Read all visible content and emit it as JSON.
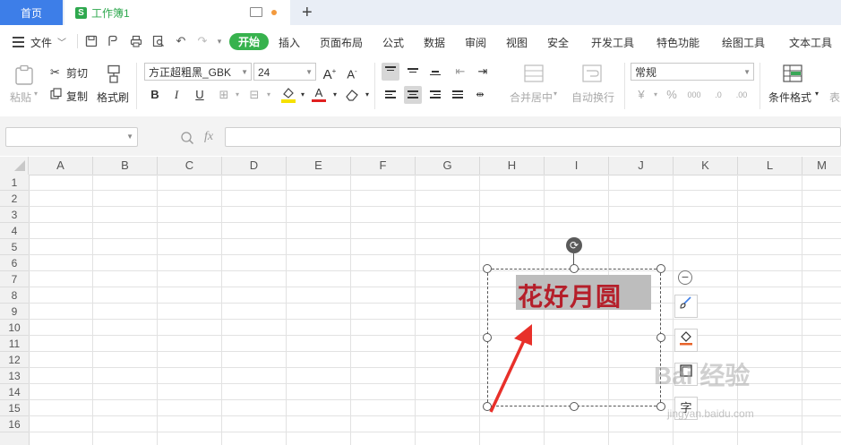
{
  "tabs": {
    "home": "首页",
    "workbook": "工作簿1",
    "new_tab": "+"
  },
  "menu": {
    "file": "文件",
    "items": [
      "开始",
      "插入",
      "页面布局",
      "公式",
      "数据",
      "审阅",
      "视图",
      "安全",
      "开发工具",
      "特色功能",
      "绘图工具",
      "文本工具"
    ]
  },
  "ribbon": {
    "paste": "粘贴",
    "cut": "剪切",
    "copy": "复制",
    "format_painter": "格式刷",
    "font_name": "方正超粗黑_GBK",
    "font_size": "24",
    "merge_center": "合并居中",
    "wrap_text": "自动换行",
    "number_format": "常规",
    "conditional_format": "条件格式",
    "table_style_partial": "表"
  },
  "formula_bar": {
    "name_box": "",
    "fx_label": "fx",
    "formula": ""
  },
  "sheet": {
    "columns": [
      "A",
      "B",
      "C",
      "D",
      "E",
      "F",
      "G",
      "H",
      "I",
      "J",
      "K",
      "L",
      "M"
    ],
    "rows": [
      "1",
      "2",
      "3",
      "4",
      "5",
      "6",
      "7",
      "8",
      "9",
      "10",
      "11",
      "12",
      "13",
      "14",
      "15",
      "16"
    ]
  },
  "textbox": {
    "text": "花好月圆",
    "text_color": "#b51f2a",
    "highlight_color": "#bdbdbd",
    "side_tools": [
      "minus-icon",
      "brush-icon",
      "fill-icon",
      "outline-icon",
      "字"
    ]
  },
  "annotation": {
    "arrow_color": "#e8302a"
  },
  "watermark": {
    "main": "Bai 经验",
    "sub": "jingyan.baidu.com"
  },
  "colors": {
    "accent": "#3d7ee8",
    "start_pill": "#37b24d",
    "sheet_icon": "#2ea84e"
  }
}
